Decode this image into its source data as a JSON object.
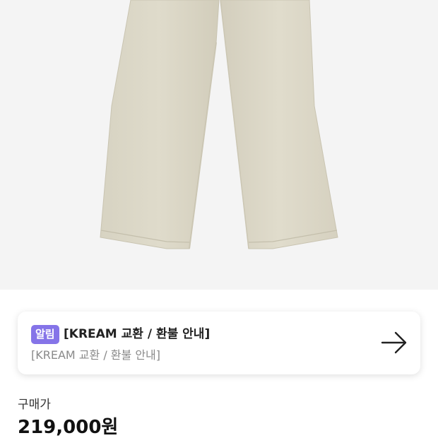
{
  "product": {
    "image_alt": "wide leg beige pants"
  },
  "notice": {
    "badge": "알림",
    "title": "[KREAM 교환 / 환불 안내]",
    "subtitle": "[KREAM 교환 / 환불 안내]",
    "arrow_icon": "arrow-right-icon"
  },
  "price": {
    "label": "구매가",
    "value": "219,000원"
  },
  "colors": {
    "badge": "#8574e8",
    "pants": "#dcd8c8",
    "image_bg": "#f4f4f4"
  }
}
